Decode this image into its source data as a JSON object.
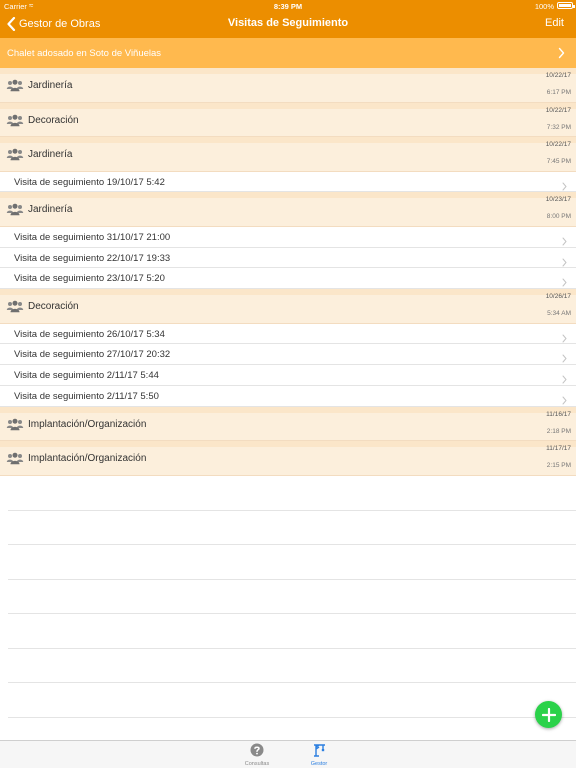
{
  "statusbar": {
    "carrier": "Carrier",
    "time": "8:39 PM",
    "battery": "100%"
  },
  "nav": {
    "back_label": "Gestor de Obras",
    "title": "Visitas de Seguimiento",
    "edit_label": "Edit"
  },
  "project": {
    "name": "Chalet adosado en Soto de Viñuelas"
  },
  "colors": {
    "header": "#ec8e00",
    "project_bar": "#ffb94e",
    "group_row": "#fcefdc",
    "fab": "#2bd24a",
    "tab_active": "#2b7fe0"
  },
  "list": {
    "rows": [
      {
        "kind": "group",
        "label": "Jardinería",
        "date": "10/22/17",
        "time": "6:17 PM",
        "icon": "users-icon"
      },
      {
        "kind": "group",
        "label": "Decoración",
        "date": "10/22/17",
        "time": "7:32 PM",
        "icon": "users-icon"
      },
      {
        "kind": "group",
        "label": "Jardinería",
        "date": "10/22/17",
        "time": "7:45 PM",
        "icon": "users-icon"
      },
      {
        "kind": "visit",
        "label": "Visita de seguimiento 19/10/17 5:42"
      },
      {
        "kind": "group",
        "label": "Jardinería",
        "date": "10/23/17",
        "time": "8:00 PM",
        "icon": "users-icon"
      },
      {
        "kind": "visit",
        "label": "Visita de seguimiento 31/10/17 21:00"
      },
      {
        "kind": "visit",
        "label": "Visita de seguimiento 22/10/17 19:33"
      },
      {
        "kind": "visit",
        "label": "Visita de seguimiento 23/10/17 5:20"
      },
      {
        "kind": "group",
        "label": "Decoración",
        "date": "10/26/17",
        "time": "5:34 AM",
        "icon": "users-icon"
      },
      {
        "kind": "visit",
        "label": "Visita de seguimiento 26/10/17 5:34"
      },
      {
        "kind": "visit",
        "label": "Visita de seguimiento 27/10/17 20:32"
      },
      {
        "kind": "visit",
        "label": "Visita de seguimiento 2/11/17 5:44"
      },
      {
        "kind": "visit",
        "label": "Visita de seguimiento 2/11/17 5:50"
      },
      {
        "kind": "group",
        "label": "Implantación/Organización",
        "date": "11/16/17",
        "time": "2:18 PM",
        "icon": "users-icon"
      },
      {
        "kind": "group",
        "label": "Implantación/Organización",
        "date": "11/17/17",
        "time": "2:15 PM",
        "icon": "users-icon"
      }
    ]
  },
  "fab": {
    "icon": "plus-icon"
  },
  "tabbar": {
    "tabs": [
      {
        "label": "Consultas",
        "icon": "question-icon",
        "active": false
      },
      {
        "label": "Gestor",
        "icon": "crane-icon",
        "active": true
      }
    ]
  }
}
